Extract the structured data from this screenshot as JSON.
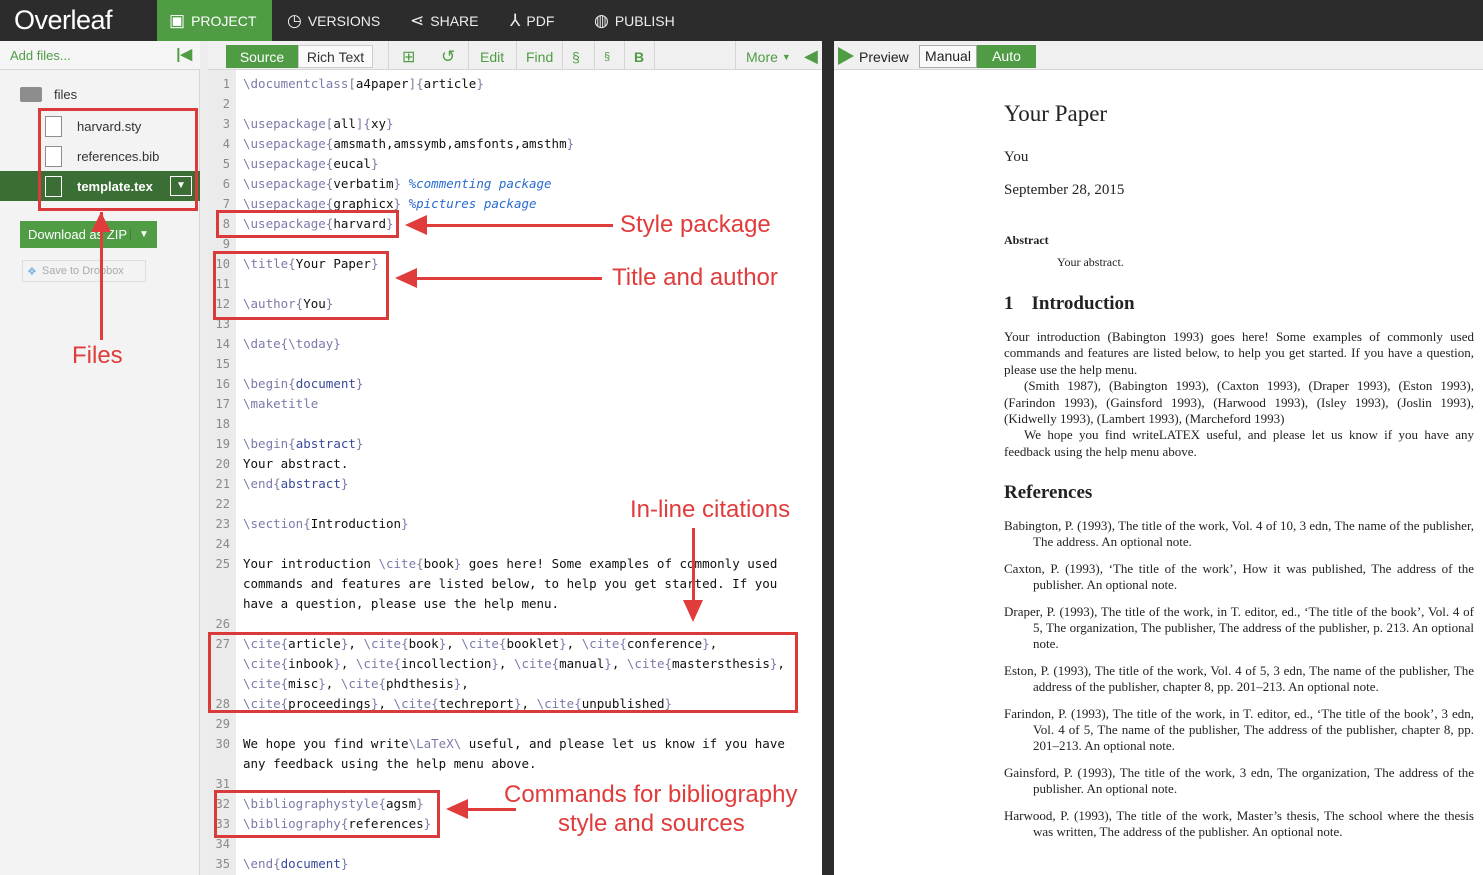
{
  "topbar": {
    "logo": "Overleaf",
    "nav": [
      {
        "label": "PROJECT",
        "icon": "project-icon"
      },
      {
        "label": "VERSIONS",
        "icon": "clock-icon"
      },
      {
        "label": "SHARE",
        "icon": "share-icon"
      },
      {
        "label": "PDF",
        "icon": "pdf-icon"
      },
      {
        "label": "PUBLISH",
        "icon": "globe-icon"
      }
    ]
  },
  "sidebar": {
    "add_files": "Add files...",
    "folder": "files",
    "files": [
      "harvard.sty",
      "references.bib",
      "template.tex"
    ],
    "selected_file": "template.tex",
    "download_label": "Download as ZIP",
    "dropbox_label": "Save to Dropbox"
  },
  "editor": {
    "toolbar": {
      "source": "Source",
      "rich_text": "Rich Text",
      "edit": "Edit",
      "find": "Find",
      "section": "§",
      "subsection": "§",
      "bold": "B",
      "more": "More"
    },
    "lines": [
      {
        "n": "1",
        "html": "<span class='kw'>\\documentclass</span><span class='kw'>[</span>a4paper<span class='kw'>]{</span>article<span class='kw'>}</span>"
      },
      {
        "n": "2",
        "html": ""
      },
      {
        "n": "3",
        "html": "<span class='kw'>\\usepackage[</span>all<span class='kw'>]{</span>xy<span class='kw'>}</span>"
      },
      {
        "n": "4",
        "html": "<span class='kw'>\\usepackage{</span>amsmath,amssymb,amsfonts,amsthm<span class='kw'>}</span>"
      },
      {
        "n": "5",
        "html": "<span class='kw'>\\usepackage{</span>eucal<span class='kw'>}</span>"
      },
      {
        "n": "6",
        "html": "<span class='kw'>\\usepackage{</span>verbatim<span class='kw'>}</span> <span class='cm'>%commenting package</span>"
      },
      {
        "n": "7",
        "html": "<span class='kw'>\\usepackage{</span>graphicx<span class='kw'>}</span> <span class='cm'>%pictures package</span>"
      },
      {
        "n": "8",
        "html": "<span class='kw'>\\usepackage{</span>harvard<span class='kw'>}</span>"
      },
      {
        "n": "9",
        "html": ""
      },
      {
        "n": "10",
        "html": "<span class='kw'>\\title{</span>Your Paper<span class='kw'>}</span>"
      },
      {
        "n": "11",
        "html": ""
      },
      {
        "n": "12",
        "html": "<span class='kw'>\\author{</span>You<span class='kw'>}</span>"
      },
      {
        "n": "13",
        "html": ""
      },
      {
        "n": "14",
        "html": "<span class='kw'>\\date{\\today}</span>"
      },
      {
        "n": "15",
        "html": ""
      },
      {
        "n": "16",
        "html": "<span class='kw'>\\begin{</span><span class='env'>document</span><span class='kw'>}</span>"
      },
      {
        "n": "17",
        "html": "<span class='kw'>\\maketitle</span>"
      },
      {
        "n": "18",
        "html": ""
      },
      {
        "n": "19",
        "html": "<span class='kw'>\\begin{</span><span class='env'>abstract</span><span class='kw'>}</span>"
      },
      {
        "n": "20",
        "html": "Your abstract."
      },
      {
        "n": "21",
        "html": "<span class='kw'>\\end{</span><span class='env'>abstract</span><span class='kw'>}</span>"
      },
      {
        "n": "22",
        "html": ""
      },
      {
        "n": "23",
        "html": "<span class='kw'>\\section{</span>Introduction<span class='kw'>}</span>"
      },
      {
        "n": "24",
        "html": ""
      },
      {
        "n": "25",
        "html": "Your introduction <span class='kw'>\\cite{</span>book<span class='kw'>}</span> goes here! Some examples of commonly used"
      },
      {
        "n": "",
        "html": "commands and features are listed below, to help you get started. If you"
      },
      {
        "n": "",
        "html": "have a question, please use the help menu."
      },
      {
        "n": "26",
        "html": ""
      },
      {
        "n": "27",
        "html": "<span class='kw'>\\cite{</span>article<span class='kw'>}</span>, <span class='kw'>\\cite{</span>book<span class='kw'>}</span>, <span class='kw'>\\cite{</span>booklet<span class='kw'>}</span>, <span class='kw'>\\cite{</span>conference<span class='kw'>}</span>,"
      },
      {
        "n": "",
        "html": "<span class='kw'>\\cite{</span>inbook<span class='kw'>}</span>, <span class='kw'>\\cite{</span>incollection<span class='kw'>}</span>, <span class='kw'>\\cite{</span>manual<span class='kw'>}</span>, <span class='kw'>\\cite{</span>mastersthesis<span class='kw'>}</span>,"
      },
      {
        "n": "",
        "html": "<span class='kw'>\\cite{</span>misc<span class='kw'>}</span>, <span class='kw'>\\cite{</span>phdthesis<span class='kw'>}</span>,"
      },
      {
        "n": "28",
        "html": "<span class='kw'>\\cite{</span>proceedings<span class='kw'>}</span>, <span class='kw'>\\cite{</span>techreport<span class='kw'>}</span>, <span class='kw'>\\cite{</span>unpublished<span class='kw'>}</span>"
      },
      {
        "n": "29",
        "html": ""
      },
      {
        "n": "30",
        "html": "We hope you find write<span class='kw'>\\LaTeX\\</span> useful, and please let us know if you have"
      },
      {
        "n": "",
        "html": "any feedback using the help menu above."
      },
      {
        "n": "31",
        "html": ""
      },
      {
        "n": "32",
        "html": "<span class='kw'>\\bibliographystyle{</span>agsm<span class='kw'>}</span>"
      },
      {
        "n": "33",
        "html": "<span class='kw'>\\bibliography{</span>references<span class='kw'>}</span>"
      },
      {
        "n": "34",
        "html": ""
      },
      {
        "n": "35",
        "html": "<span class='kw'>\\end{</span><span class='env'>document</span><span class='kw'>}</span>"
      }
    ]
  },
  "preview": {
    "label": "Preview",
    "manual": "Manual",
    "auto": "Auto",
    "pdf": {
      "title": "Your Paper",
      "author": "You",
      "date": "September 28, 2015",
      "abstract_heading": "Abstract",
      "abstract_text": "Your abstract.",
      "section_number": "1",
      "section_title": "Introduction",
      "intro_p1": "Your introduction (Babington 1993) goes here! Some examples of commonly used commands and features are listed below, to help you get started. If you have a question, please use the help menu.",
      "intro_p2": "(Smith 1987), (Babington 1993), (Caxton 1993), (Draper 1993), (Eston 1993), (Farindon 1993), (Gainsford 1993), (Harwood 1993), (Isley 1993), (Joslin 1993), (Kidwelly 1993), (Lambert 1993), (Marcheford 1993)",
      "intro_p3": "We hope you find writeLATEX useful, and please let us know if you have any feedback using the help menu above.",
      "refs_heading": "References",
      "refs": [
        "Babington, P. (1993), The title of the work, Vol. 4 of 10, 3 edn, The name of the publisher, The address. An optional note.",
        "Caxton, P. (1993), ‘The title of the work’, How it was published, The address of the publisher. An optional note.",
        "Draper, P. (1993), The title of the work, in T. editor, ed., ‘The title of the book’, Vol. 4 of 5, The organization, The publisher, The address of the publisher, p. 213. An optional note.",
        "Eston, P. (1993), The title of the work, Vol. 4 of 5, 3 edn, The name of the publisher, The address of the publisher, chapter 8, pp. 201–213. An optional note.",
        "Farindon, P. (1993), The title of the work, in T. editor, ed., ‘The title of the book’, 3 edn, Vol. 4 of 5, The name of the publisher, The address of the publisher, chapter 8, pp. 201–213. An optional note.",
        "Gainsford, P. (1993), The title of the work, 3 edn, The organization, The address of the publisher. An optional note.",
        "Harwood, P. (1993), The title of the work, Master’s thesis, The school where the thesis was written, The address of the publisher. An optional note."
      ]
    }
  },
  "annotations": {
    "files": "Files",
    "style_package": "Style package",
    "title_author": "Title and author",
    "citations": "In-line citations",
    "bib_line1": "Commands for bibliography",
    "bib_line2": "style and sources"
  }
}
